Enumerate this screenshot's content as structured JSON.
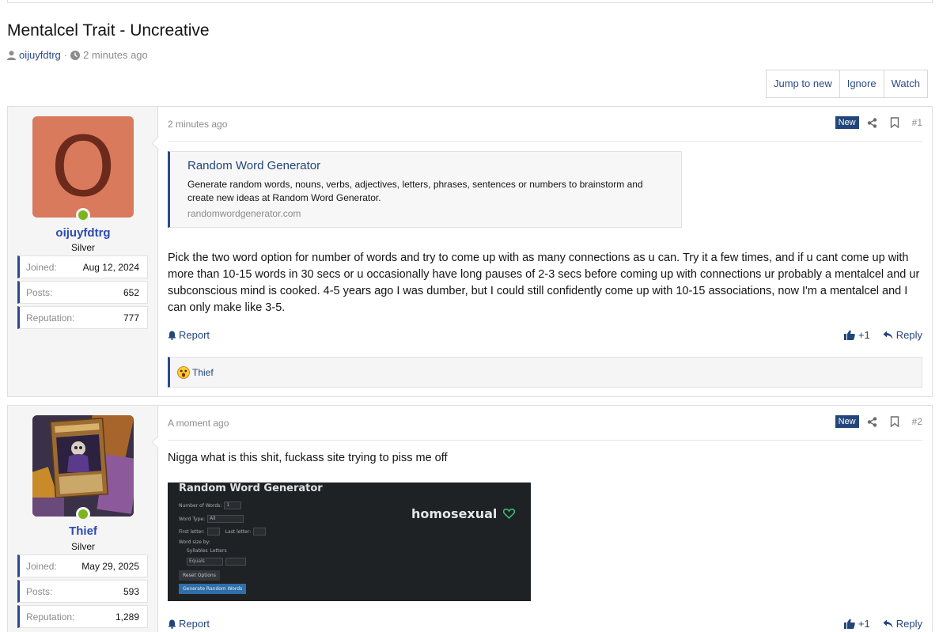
{
  "thread": {
    "title": "Mentalcel Trait - Uncreative",
    "author": "oijuyfdtrg",
    "separator": "·",
    "time": "2 minutes ago"
  },
  "actions": {
    "jump_to_new": "Jump to new",
    "ignore": "Ignore",
    "watch": "Watch"
  },
  "posts": [
    {
      "avatar_letter": "O",
      "username": "oijuyfdtrg",
      "user_title": "Silver",
      "stats": [
        {
          "label": "Joined:",
          "value": "Aug 12, 2024"
        },
        {
          "label": "Posts:",
          "value": "652"
        },
        {
          "label": "Reputation:",
          "value": "777"
        }
      ],
      "date": "2 minutes ago",
      "badge": "New",
      "number": "#1",
      "embed": {
        "title": "Random Word Generator",
        "description": "Generate random words, nouns, verbs, adjectives, letters, phrases, sentences or numbers to brainstorm and create new ideas at Random Word Generator.",
        "host": "randomwordgenerator.com"
      },
      "body": "Pick the two word option for number of words and try to come up with as many connections as u can. Try it a few times, and if u cant come up with more than 10-15 words in 30 secs or u occasionally have long pauses of 2-3 secs before coming up with connections ur probably a mentalcel and ur subconscious mind is cooked. 4-5 years ago I was dumber, but I could still confidently come up with 10-15 associations, now I'm a mentalcel and I can only make like 3-5.",
      "report": "Report",
      "like": "+1",
      "reply": "Reply",
      "reaction_user": "Thief"
    },
    {
      "username": "Thief",
      "user_title": "Silver",
      "stats": [
        {
          "label": "Joined:",
          "value": "May 29, 2025"
        },
        {
          "label": "Posts:",
          "value": "593"
        },
        {
          "label": "Reputation:",
          "value": "1,289"
        }
      ],
      "date": "A moment ago",
      "badge": "New",
      "number": "#2",
      "body": "Nigga what is this shit, fuckass site trying to piss me off",
      "screenshot": {
        "title": "Random Word Generator",
        "num_words_label": "Number of Words:",
        "num_words_value": "1",
        "word_type_label": "Word Type:",
        "word_type_value": "All",
        "first_letter_label": "First letter:",
        "last_letter_label": "Last letter:",
        "word_size_label": "Word size by:",
        "syllables_label": "Syllables",
        "letters_label": "Letters",
        "equals_label": "Equals",
        "reset_label": "Reset Options",
        "generate_label": "Generate Random Words",
        "result_word": "homosexual"
      },
      "report": "Report",
      "like": "+1",
      "reply": "Reply"
    }
  ],
  "colors": {
    "link": "#2c4a8a",
    "accent": "#22467a",
    "username": "#2c4ab0",
    "online": "#7ab51d",
    "avatar_bg": "#d97a5c"
  }
}
